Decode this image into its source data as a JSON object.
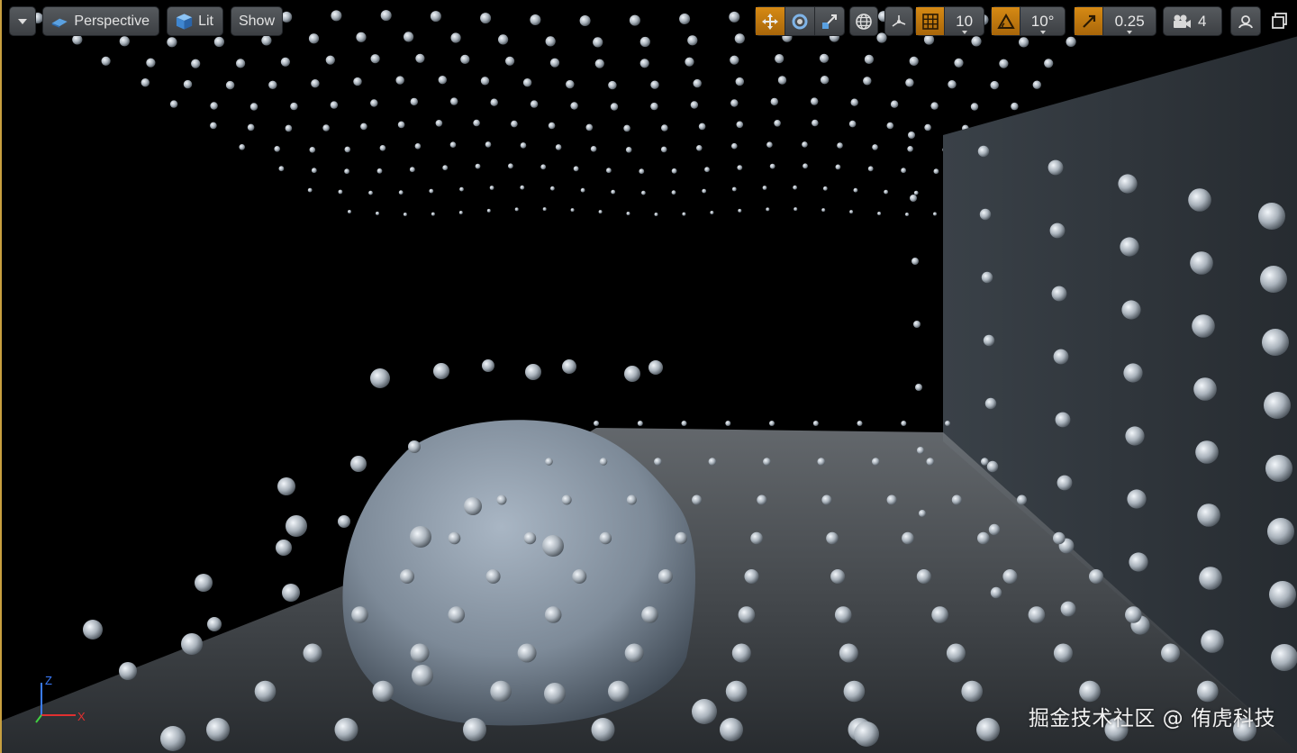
{
  "toolbar": {
    "view_mode": "Perspective",
    "lighting": "Lit",
    "show": "Show",
    "grid_snap": "10",
    "rotation_snap": "10°",
    "scale_snap": "0.25",
    "camera_speed": "4"
  },
  "icons": {
    "options_menu": "chevron-down-icon",
    "perspective": "perspective-cube-icon",
    "lit": "lit-cube-icon",
    "translate": "translate-icon",
    "rotate": "rotate-icon",
    "scale": "scale-icon",
    "world": "world-icon",
    "surface_snap": "surface-snap-icon",
    "grid": "grid-icon",
    "rotation": "rotation-snap-icon",
    "scale_snap": "scale-snap-icon",
    "camera": "camera-icon",
    "maximize": "maximize-icon"
  },
  "axis_gizmo": {
    "z": "Z",
    "x": "X"
  },
  "watermark": "掘金技术社区 @ 侑虎科技",
  "colors": {
    "accent": "#d68a14",
    "viewport_border": "#c8a040"
  }
}
